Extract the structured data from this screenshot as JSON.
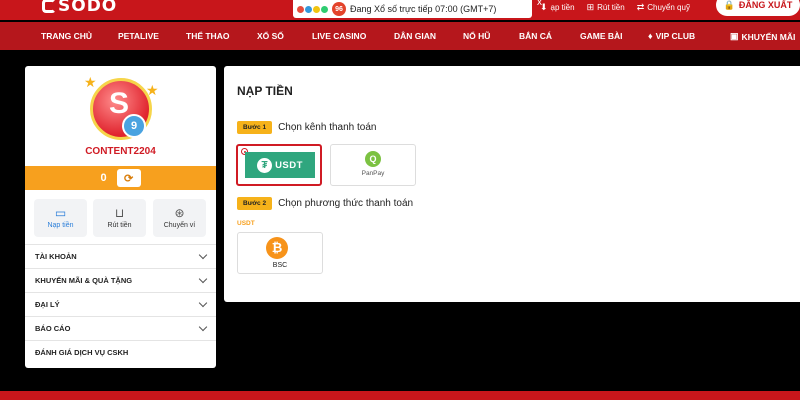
{
  "brand": {
    "logo_text": "SODO"
  },
  "lottery": {
    "badge": "96",
    "text": "Đang Xổ số trực tiếp 07:00 (GMT+7)",
    "close": "x"
  },
  "top_actions": [
    {
      "label": "ạp tiền",
      "icon": "deposit-icon"
    },
    {
      "label": "Rút tiền",
      "icon": "withdraw-icon"
    },
    {
      "label": "Chuyển quỹ",
      "icon": "transfer-icon"
    }
  ],
  "logout_label": "ĐĂNG XUẤT",
  "nav": [
    {
      "label": "TRANG CHỦ"
    },
    {
      "label": "PETALIVE"
    },
    {
      "label": "THỂ THAO"
    },
    {
      "label": "XỔ SỐ"
    },
    {
      "label": "LIVE CASINO"
    },
    {
      "label": "DÂN GIAN"
    },
    {
      "label": "NỔ HŨ"
    },
    {
      "label": "BẮN CÁ"
    },
    {
      "label": "GAME BÀI"
    },
    {
      "label": "VIP CLUB",
      "icon": "diamond-icon"
    },
    {
      "label": "KHUYẾN MÃI",
      "icon": "gift-icon"
    }
  ],
  "profile": {
    "avatar_number": "9",
    "username": "CONTENT2204",
    "balance": "0"
  },
  "quick_actions": [
    {
      "label": "Nạp tiền",
      "icon": "card-icon"
    },
    {
      "label": "Rút tiền",
      "icon": "cart-icon"
    },
    {
      "label": "Chuyển ví",
      "icon": "wallet-transfer-icon"
    }
  ],
  "menu": [
    {
      "label": "TÀI KHOẢN"
    },
    {
      "label": "KHUYẾN MÃI & QUÀ TẶNG"
    },
    {
      "label": "ĐẠI LÝ"
    },
    {
      "label": "BÁO CÁO"
    },
    {
      "label": "ĐÁNH GIÁ DỊCH VỤ CSKH"
    }
  ],
  "main": {
    "title": "NẠP TIỀN",
    "step1": {
      "badge": "Bước 1",
      "text": "Chọn kênh thanh toán"
    },
    "channels": [
      {
        "label": "USDT",
        "selected": true
      },
      {
        "label": "PanPay",
        "selected": false
      }
    ],
    "step2": {
      "badge": "Bước 2",
      "text": "Chọn phương thức thanh toán"
    },
    "method_section": "USDT",
    "methods": [
      {
        "label": "BSC"
      }
    ]
  },
  "colors": {
    "primary_red": "#c8161b",
    "accent_orange": "#f7a01e",
    "usdt_green": "#2fa67e"
  }
}
